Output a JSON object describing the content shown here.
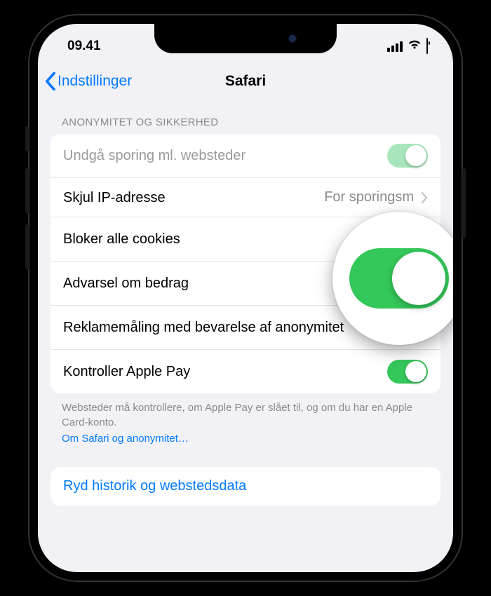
{
  "status": {
    "time": "09.41"
  },
  "nav": {
    "back_label": "Indstillinger",
    "title": "Safari"
  },
  "section": {
    "header": "Anonymitet og sikkerhed"
  },
  "rows": {
    "prevent_tracking": {
      "label": "Undgå sporing ml. websteder",
      "on": true
    },
    "hide_ip": {
      "label": "Skjul IP-adresse",
      "detail": "For sporingsm"
    },
    "block_cookies": {
      "label": "Bloker alle cookies",
      "on": true
    },
    "fraud_warning": {
      "label": "Advarsel om bedrag",
      "on": true
    },
    "ad_measurement": {
      "label": "Reklamemåling med bevarelse af anonymitet",
      "on": true
    },
    "check_apple_pay": {
      "label": "Kontroller Apple Pay",
      "on": true
    }
  },
  "footer": {
    "text": "Websteder må kontrollere, om Apple Pay er slået til, og om du har en Apple Card-konto.",
    "link": "Om Safari og anonymitet…"
  },
  "action": {
    "clear": "Ryd historik og webstedsdata"
  }
}
